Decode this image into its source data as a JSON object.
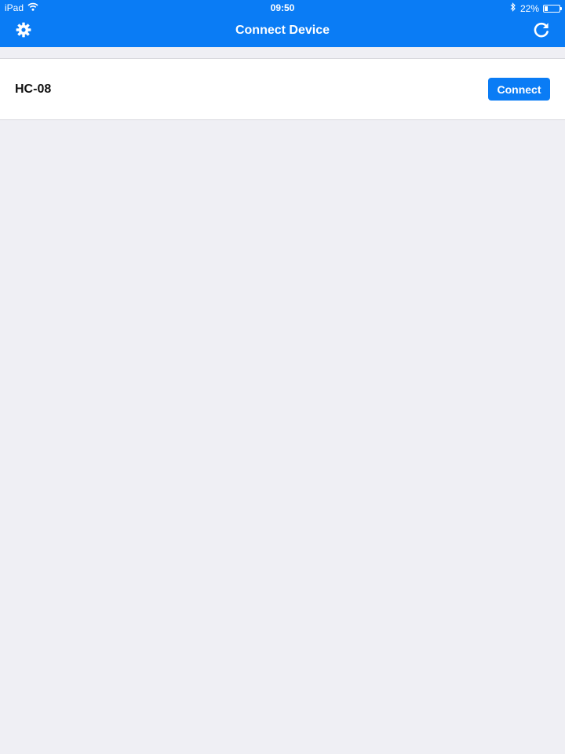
{
  "status_bar": {
    "device": "iPad",
    "time": "09:50",
    "battery_text": "22%",
    "battery_level": 0.22,
    "icons": [
      "wifi-icon",
      "bluetooth-icon",
      "battery-icon"
    ]
  },
  "nav": {
    "title": "Connect Device",
    "left_icon": "gear-icon",
    "right_icon": "refresh-icon"
  },
  "devices": [
    {
      "name": "HC-08",
      "action_label": "Connect"
    }
  ],
  "colors": {
    "accent": "#0a7cf5",
    "background": "#efeff4",
    "row_background": "#ffffff"
  }
}
